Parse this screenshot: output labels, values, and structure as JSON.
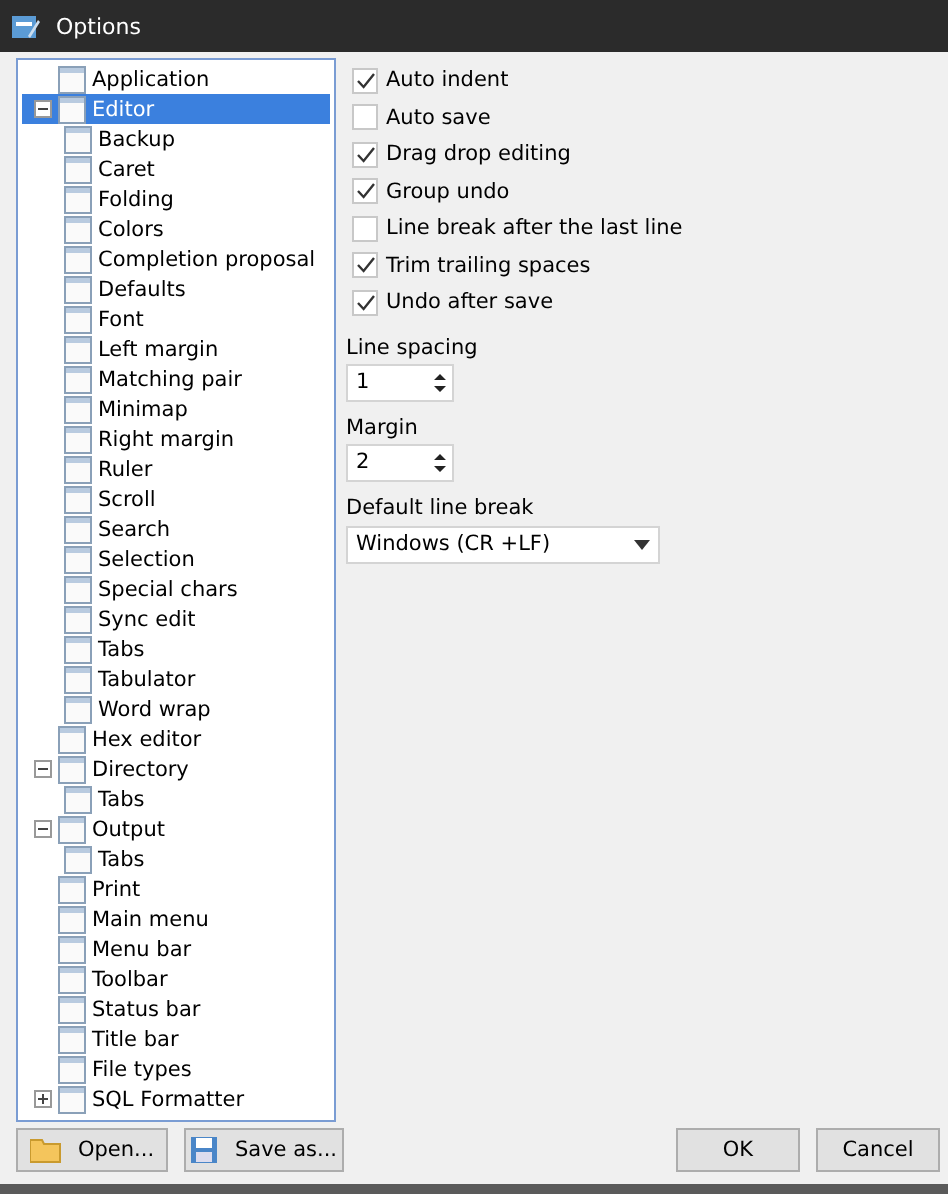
{
  "window": {
    "title": "Options"
  },
  "tree": [
    {
      "label": "Application",
      "selected": false
    },
    {
      "label": "Editor",
      "selected": true,
      "expanded": true,
      "children": [
        {
          "label": "Backup",
          "selected": false
        },
        {
          "label": "Caret",
          "selected": false
        },
        {
          "label": "Folding",
          "selected": false
        },
        {
          "label": "Colors",
          "selected": false
        },
        {
          "label": "Completion proposal",
          "selected": false
        },
        {
          "label": "Defaults",
          "selected": false
        },
        {
          "label": "Font",
          "selected": false
        },
        {
          "label": "Left margin",
          "selected": false
        },
        {
          "label": "Matching pair",
          "selected": false
        },
        {
          "label": "Minimap",
          "selected": false
        },
        {
          "label": "Right margin",
          "selected": false
        },
        {
          "label": "Ruler",
          "selected": false
        },
        {
          "label": "Scroll",
          "selected": false
        },
        {
          "label": "Search",
          "selected": false
        },
        {
          "label": "Selection",
          "selected": false
        },
        {
          "label": "Special chars",
          "selected": false
        },
        {
          "label": "Sync edit",
          "selected": false
        },
        {
          "label": "Tabs",
          "selected": false
        },
        {
          "label": "Tabulator",
          "selected": false
        },
        {
          "label": "Word wrap",
          "selected": false
        }
      ]
    },
    {
      "label": "Hex editor",
      "selected": false
    },
    {
      "label": "Directory",
      "selected": false,
      "expanded": true,
      "children": [
        {
          "label": "Tabs",
          "selected": false
        }
      ]
    },
    {
      "label": "Output",
      "selected": false,
      "expanded": true,
      "children": [
        {
          "label": "Tabs",
          "selected": false
        }
      ]
    },
    {
      "label": "Print",
      "selected": false
    },
    {
      "label": "Main menu",
      "selected": false
    },
    {
      "label": "Menu bar",
      "selected": false
    },
    {
      "label": "Toolbar",
      "selected": false
    },
    {
      "label": "Status bar",
      "selected": false
    },
    {
      "label": "Title bar",
      "selected": false
    },
    {
      "label": "File types",
      "selected": false
    },
    {
      "label": "SQL Formatter",
      "selected": false,
      "expanded": false
    }
  ],
  "options": [
    {
      "label": "Auto indent",
      "checked": true
    },
    {
      "label": "Auto save",
      "checked": false
    },
    {
      "label": "Drag drop editing",
      "checked": true
    },
    {
      "label": "Group undo",
      "checked": true
    },
    {
      "label": "Line break after the last line",
      "checked": false
    },
    {
      "label": "Trim trailing spaces",
      "checked": true
    },
    {
      "label": "Undo after save",
      "checked": true
    }
  ],
  "spinners": [
    {
      "label": "Line spacing",
      "value": "1"
    },
    {
      "label": "Margin",
      "value": "2"
    }
  ],
  "dropdown": {
    "label": "Default line break",
    "value": "Windows (CR +LF)"
  },
  "left_buttons": [
    "Open...",
    "Save as..."
  ],
  "right_buttons": [
    "OK",
    "Cancel"
  ]
}
